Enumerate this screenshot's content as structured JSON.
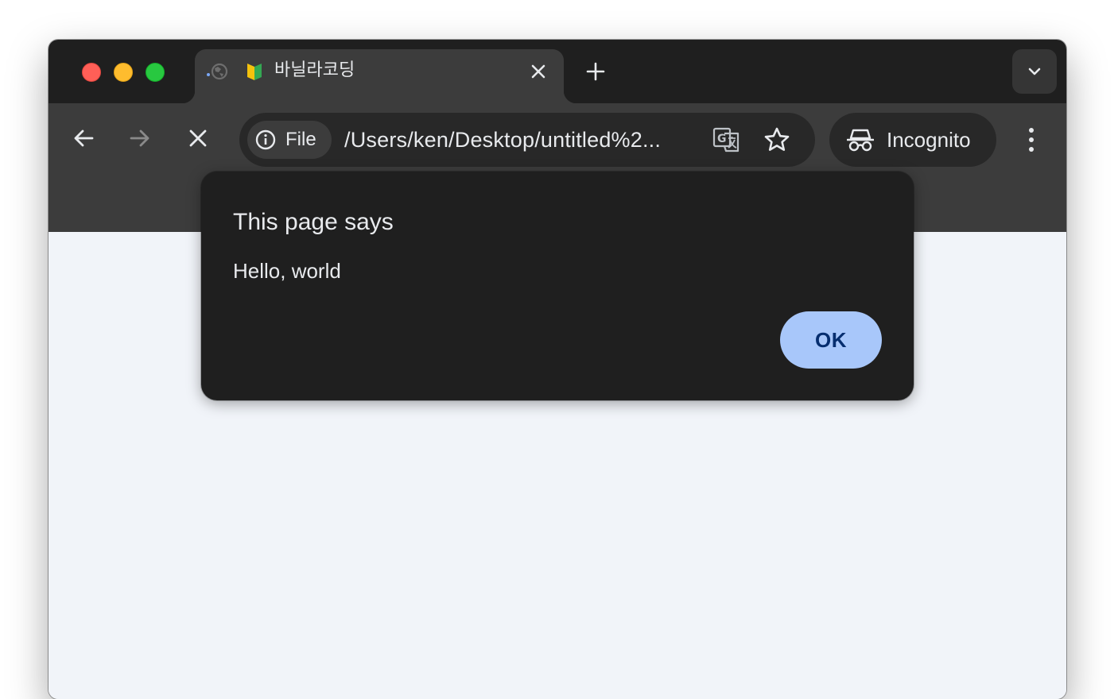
{
  "window": {
    "tab": {
      "title": "바닐라코딩",
      "favicon": "beginner-symbol-icon",
      "loading": true
    },
    "toolbar": {
      "site_info_label": "File",
      "url": "/Users/ken/Desktop/untitled%2...",
      "profile_label": "Incognito"
    }
  },
  "dialog": {
    "title": "This page says",
    "message": "Hello, world",
    "ok_label": "OK"
  },
  "colors": {
    "titlebar": "#1f1f1f",
    "toolbar": "#3c3c3c",
    "page_background": "#f1f4f9",
    "dialog_background": "#1f1f1f",
    "ok_button": "#a8c7fa",
    "ok_text": "#062e6f"
  }
}
